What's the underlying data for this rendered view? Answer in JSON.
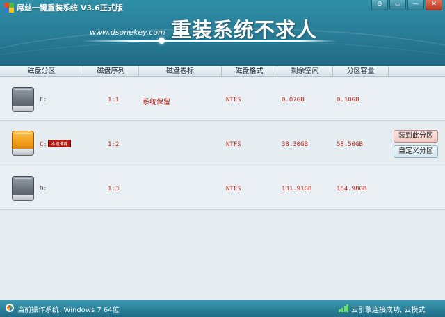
{
  "window": {
    "title": "屌丝一键重装系统 V3.6正式版",
    "controls": {
      "feedback": "⊖",
      "skin": "▭",
      "minimize": "—",
      "close": "✕"
    }
  },
  "header": {
    "site_url": "www.dsonekey.com",
    "slogan": "重装系统不求人"
  },
  "columns": [
    "磁盘分区",
    "磁盘序列",
    "磁盘卷标",
    "磁盘格式",
    "剩余空间",
    "分区容量"
  ],
  "partitions": [
    {
      "drive": "E:",
      "sequence": "1:1",
      "label": "系统保留",
      "format": "NTFS",
      "free": "0.07GB",
      "capacity": "0.10GB",
      "icon": "gray-drive-icon"
    },
    {
      "drive": "C:",
      "badge": "本机推荐",
      "sequence": "1:2",
      "label": "",
      "format": "NTFS",
      "free": "38.30GB",
      "capacity": "58.50GB",
      "icon": "orange-drive-icon"
    },
    {
      "drive": "D:",
      "sequence": "1:3",
      "label": "",
      "format": "NTFS",
      "free": "131.91GB",
      "capacity": "164.98GB",
      "icon": "gray-drive-icon"
    }
  ],
  "actions": {
    "install_here": "装到此分区",
    "custom_partition": "自定义分区"
  },
  "status": {
    "os_text": "当前操作系统: Windows 7 64位",
    "cloud_text": "云引擎连接成功, 云模式"
  },
  "colors": {
    "header": "#2a7f99",
    "accent_red": "#b5261a",
    "status_bar": "#1f6c86"
  }
}
